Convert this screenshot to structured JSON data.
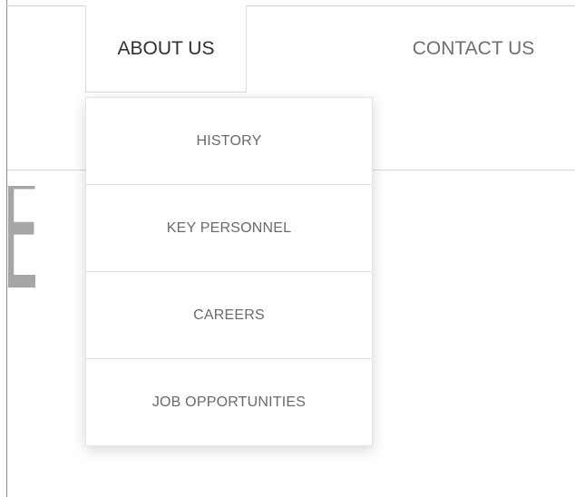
{
  "nav": {
    "about_label": "ABOUT US",
    "contact_label": "CONTACT US"
  },
  "dropdown": {
    "items": [
      {
        "label": "HISTORY"
      },
      {
        "label": "KEY PERSONNEL"
      },
      {
        "label": "CAREERS"
      },
      {
        "label": "JOB OPPORTUNITIES"
      }
    ]
  },
  "hero": {
    "text_fragment": "NE"
  },
  "colors": {
    "background": "#ffffff",
    "nav_active_text": "#2f2f2f",
    "nav_text": "#6f6f6f",
    "dropdown_text": "#6a6a6a",
    "divider": "#e2e2e2",
    "hero_text": "#a6a6a6"
  }
}
